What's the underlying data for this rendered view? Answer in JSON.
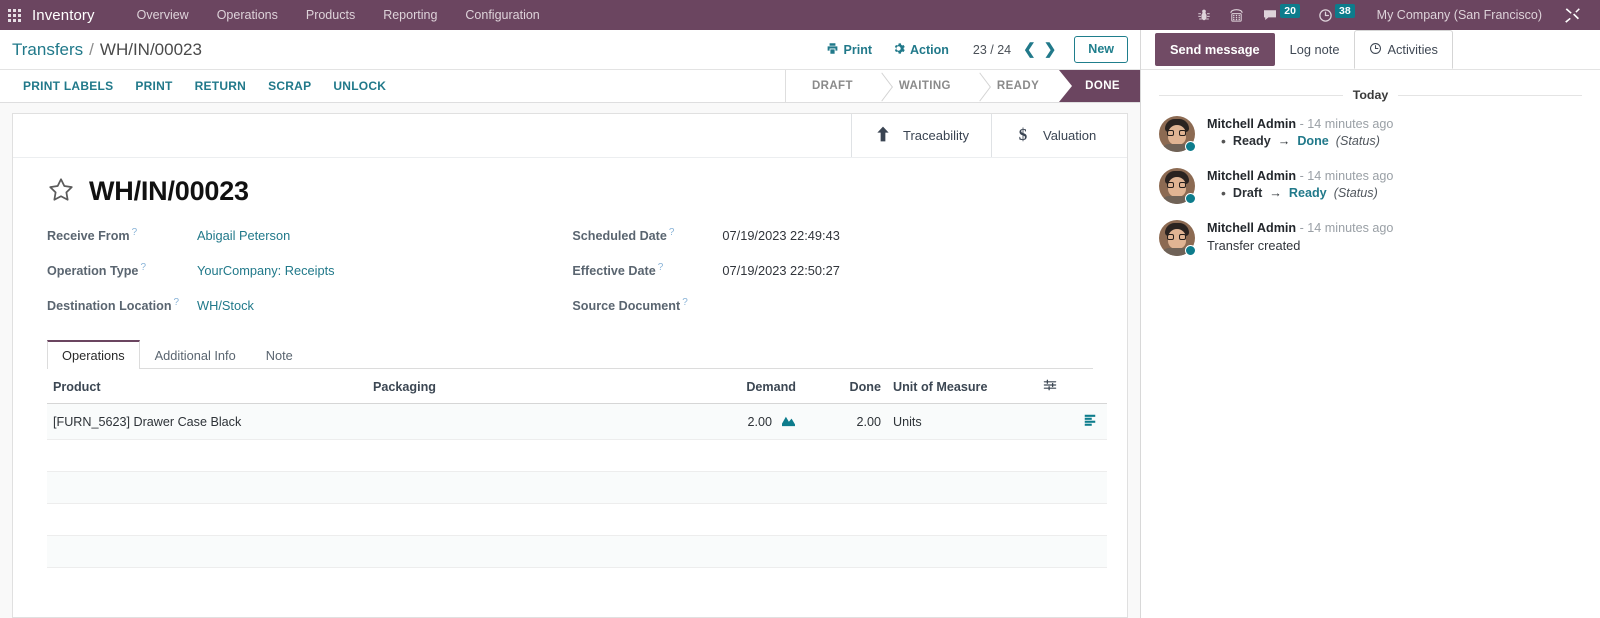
{
  "navbar": {
    "app_name": "Inventory",
    "menu": [
      "Overview",
      "Operations",
      "Products",
      "Reporting",
      "Configuration"
    ],
    "icons": [
      {
        "name": "bug-icon"
      },
      {
        "name": "phone-keypad-icon"
      },
      {
        "name": "messages-icon",
        "badge": "20"
      },
      {
        "name": "activities-clock-icon",
        "badge": "38"
      }
    ],
    "company": "My Company (San Francisco)",
    "tools_icon": "tools-icon",
    "brand_color": "#6b4560",
    "badge_color": "#0d7c8c"
  },
  "control_panel": {
    "breadcrumb_root": "Transfers",
    "breadcrumb_sep": "/",
    "breadcrumb_current": "WH/IN/00023",
    "print_label": "Print",
    "action_label": "Action",
    "pager": "23 / 24",
    "prev_icon": "chevron-left-icon",
    "next_icon": "chevron-right-icon",
    "new_label": "New"
  },
  "statusbar": {
    "buttons": [
      "PRINT LABELS",
      "PRINT",
      "RETURN",
      "SCRAP",
      "UNLOCK"
    ],
    "stages": [
      {
        "label": "DRAFT",
        "active": false
      },
      {
        "label": "WAITING",
        "active": false
      },
      {
        "label": "READY",
        "active": false
      },
      {
        "label": "DONE",
        "active": true
      }
    ],
    "active_color": "#6b4560"
  },
  "smart_buttons": [
    {
      "label": "Traceability",
      "icon": "up-arrow-icon"
    },
    {
      "label": "Valuation",
      "icon": "dollar-sign-icon"
    }
  ],
  "record": {
    "title": "WH/IN/00023",
    "star_icon": "star-outline-icon",
    "left_fields": [
      {
        "label": "Receive From",
        "value": "Abigail Peterson",
        "link": true,
        "help": "?"
      },
      {
        "label": "Operation Type",
        "value": "YourCompany: Receipts",
        "link": true,
        "help": "?"
      },
      {
        "label": "Destination Location",
        "value": "WH/Stock",
        "link": true,
        "help": "?"
      }
    ],
    "right_fields": [
      {
        "label": "Scheduled Date",
        "value": "07/19/2023 22:49:43",
        "link": false,
        "help": "?"
      },
      {
        "label": "Effective Date",
        "value": "07/19/2023 22:50:27",
        "link": false,
        "help": "?"
      },
      {
        "label": "Source Document",
        "value": "",
        "link": false,
        "help": "?"
      }
    ]
  },
  "notebook": {
    "tabs": [
      {
        "label": "Operations",
        "active": true
      },
      {
        "label": "Additional Info",
        "active": false
      },
      {
        "label": "Note",
        "active": false
      }
    ],
    "columns": [
      "Product",
      "Packaging",
      "Demand",
      "Done",
      "Unit of Measure"
    ],
    "optional_columns_icon": "column-options-icon",
    "rows": [
      {
        "product": "[FURN_5623] Drawer Case Black",
        "packaging": "",
        "demand": "2.00",
        "demand_icon": "forecast-chart-icon",
        "done": "2.00",
        "uom": "Units",
        "detail_icon": "detailed-operations-icon"
      }
    ],
    "empty_rows": 4
  },
  "chatter": {
    "send_message_label": "Send message",
    "log_note_label": "Log note",
    "activities_label": "Activities",
    "activities_icon": "clock-icon",
    "day_separator": "Today",
    "messages": [
      {
        "author": "Mitchell Admin",
        "time": "- 14 minutes ago",
        "tracking": {
          "old": "Ready",
          "arrow": "→",
          "new": "Done",
          "field": "(Status)"
        },
        "body": ""
      },
      {
        "author": "Mitchell Admin",
        "time": "- 14 minutes ago",
        "tracking": {
          "old": "Draft",
          "arrow": "→",
          "new": "Ready",
          "field": "(Status)"
        },
        "body": ""
      },
      {
        "author": "Mitchell Admin",
        "time": "- 14 minutes ago",
        "tracking": null,
        "body": "Transfer created"
      }
    ]
  }
}
